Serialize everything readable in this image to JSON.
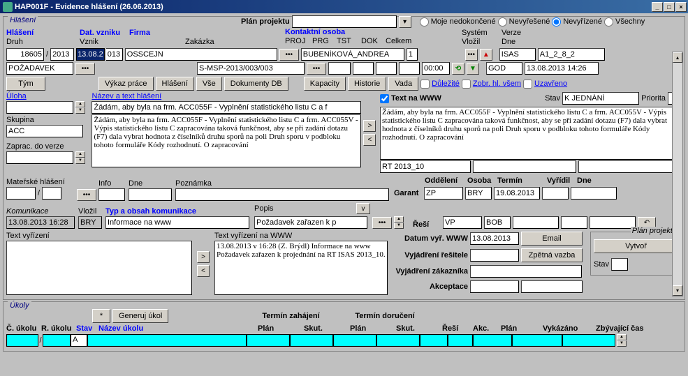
{
  "title": "HAP001F - Evidence hlášení (26.06.2013)",
  "topFilters": {
    "plan_projektu": "Plán projektu",
    "r1": "Moje nedokončené",
    "r2": "Nevyřešené",
    "r3": "Nevyřízené",
    "r4": "Všechny"
  },
  "hlaseni": {
    "legend": "Hlášení",
    "lbl_hlaseni": "Hlášení",
    "lbl_druh": "Druh",
    "lbl_dat_vzniku": "Dat. vzniku",
    "lbl_firma": "Firma",
    "lbl_vznik": "Vznik",
    "lbl_zakazka": "Zakázka",
    "lbl_kontaktni_osoba": "Kontaktní osoba",
    "lbl_proj": "PROJ",
    "lbl_prg": "PRG",
    "lbl_tst": "TST",
    "lbl_dok": "DOK",
    "lbl_celkem": "Celkem",
    "lbl_system": "Systém",
    "lbl_verze": "Verze",
    "lbl_vlozil": "Vložil",
    "lbl_dne": "Dne",
    "num": "18605",
    "rok": "2013",
    "dat_vzniku": "13.08.2",
    "dat_roku": "013",
    "firma": "OSSCEJN",
    "druh": "POŽADAVEK",
    "zakazka": "S-MSP-2013/003/003",
    "kontakt": "BUBENÍKOVÁ_ANDREA",
    "kontakt_n": "1",
    "celkem": "00:00",
    "system": "ISAS",
    "verze": "A1_2_8_2",
    "vlozil": "GOD",
    "dne": "13.08.2013 14:26",
    "btn_tym": "Tým",
    "btn_vykaz": "Výkaz práce",
    "btn_hlaseni": "Hlášení",
    "btn_vse": "Vše",
    "btn_dokdb": "Dokumenty DB",
    "btn_kapacity": "Kapacity",
    "btn_historie": "Historie",
    "btn_vada": "Vada",
    "chk_dulezite": "Důležité",
    "chk_zobr": "Zobr. hl. všem",
    "chk_uzavreno": "Uzavřeno",
    "lbl_uloha": "Úloha",
    "lbl_skupina": "Skupina",
    "skupina": "ACC",
    "lbl_zaprac": "Zaprac. do verze",
    "lbl_nazev": "Název a text hlášení",
    "nazev_text": "Žádám, aby byla na frm. ACC055F - Vyplnění statistického listu C a f",
    "body_text": "Žádám, aby byla na frm. ACC055F - Vyplnění statistického listu C a frm. ACC055V - Výpis statistického listu C zapracována taková funkčnost, aby se při zadání dotazu (F7) dala vybrat hodnota z číselníků druhu sporů na poli Druh sporu v podbloku tohoto formuláře Kódy rozhodnutí. O zapracování",
    "lbl_textwww": "Text na WWW",
    "lbl_stav": "Stav",
    "stav": "K JEDNÁNÍ",
    "lbl_priorita": "Priorita",
    "www_text": "Žádám, aby byla na frm. ACC055F - Vyplnění statistického listu C a frm. ACC055V - Výpis statistického listu C zapracována taková funkčnost, aby se při zadání dotazu (F7) dala vybrat hodnota z číselníků druhu sporů na poli Druh sporu v podbloku tohoto formuláře Kódy rozhodnutí. O zapracování",
    "rt_text": "RT 2013_10",
    "lbl_materske": "Mateřské hlášení",
    "lbl_info": "Info",
    "lbl_dne2": "Dne",
    "lbl_poznamka": "Poznámka",
    "lbl_oddeleni": "Oddělení",
    "lbl_osoba": "Osoba",
    "lbl_termin": "Termín",
    "lbl_vyridil": "Vyřídil",
    "lbl_dne3": "Dne",
    "lbl_garant": "Garant",
    "lbl_resi": "Řeší",
    "garant_odd": "ZP",
    "garant_osoba": "BRY",
    "garant_termin": "19.08.2013",
    "resi_odd": "VP",
    "resi_osoba": "BOB"
  },
  "kom": {
    "lbl_komunikace": "Komunikace",
    "lbl_vlozil": "Vložil",
    "lbl_typ": "Typ a obsah komunikace",
    "lbl_popis": "Popis",
    "btn_v": "v",
    "dt": "13.08.2013 16:28",
    "vlozil": "BRY",
    "typ": "Informace na www",
    "popis": "Požadavek zařazen k p"
  },
  "vyriz": {
    "lbl_text_vyr": "Text vyřízení",
    "lbl_text_vyr_www": "Text vyřízení na WWW",
    "www_body": "13.08.2013 v 16:28 (Z. Brýdl) Informace na www\nPožadavek zařazen k projednání na RT ISAS 2013_10.",
    "lbl_datum_vyr": "Datum vyř. WWW",
    "datum_vyr": "13.08.2013",
    "btn_email": "Email",
    "lbl_vyj_res": "Vyjádření řešitele",
    "btn_zpet": "Zpětná vazba",
    "lbl_vyj_zak": "Vyjádření zákazníka",
    "lbl_akceptace": "Akceptace",
    "lbl_plan_proj": "Plán projektu",
    "btn_vytvor": "Vytvoř",
    "lbl_stav2": "Stav"
  },
  "ukoly": {
    "legend": "Úkoly",
    "btn_star": "*",
    "btn_gen": "Generuj úkol",
    "hdr_termin_zah": "Termín zahájení",
    "hdr_termin_dor": "Termín doručení",
    "h_cislo": "Č. úkolu",
    "h_rok": "R. úkolu",
    "h_stav": "Stav",
    "h_nazev": "Název úkolu",
    "h_plan": "Plán",
    "h_skut": "Skut.",
    "h_resi": "Řeší",
    "h_akc": "Akc.",
    "h_plan2": "Plán",
    "h_vykazano": "Vykázáno",
    "h_zbyv": "Zbývající čas",
    "stav_val": "A"
  }
}
